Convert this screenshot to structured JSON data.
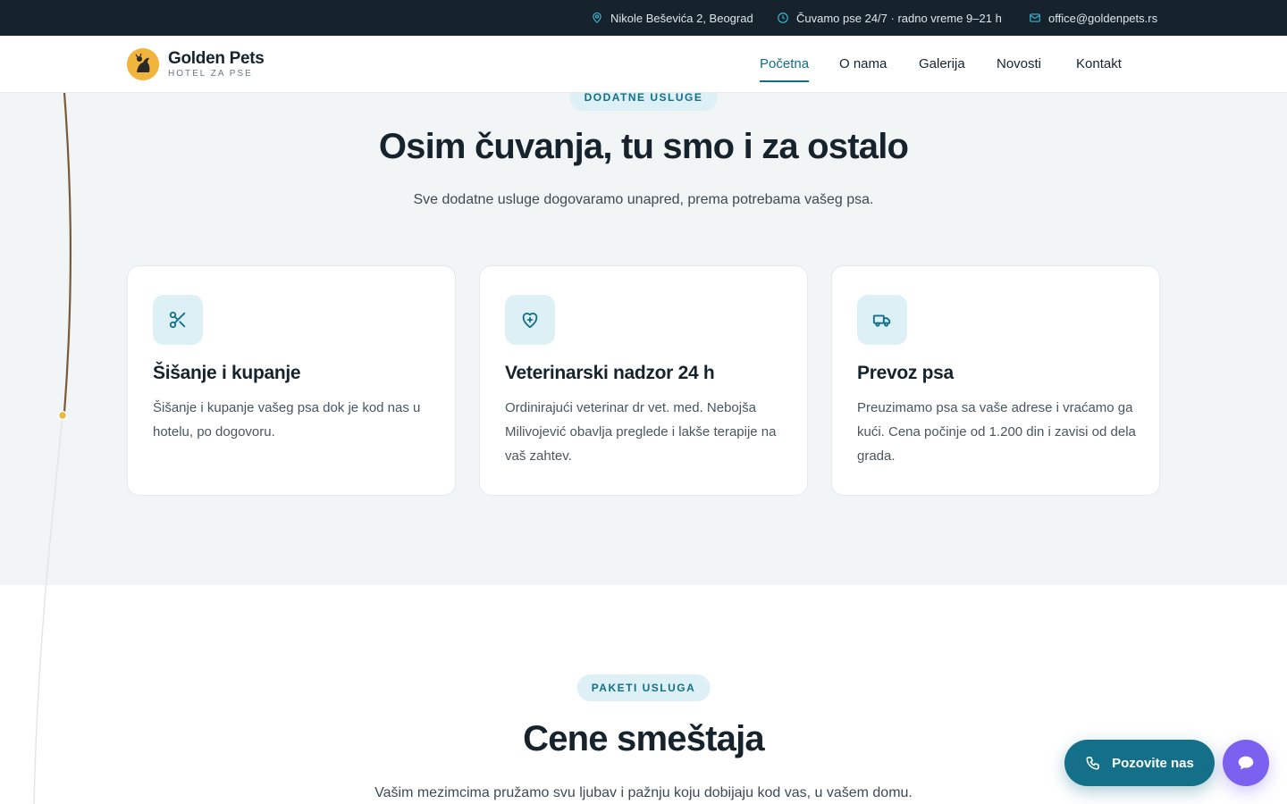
{
  "topbar": {
    "address": "Nikole Beševića 2, Beograd",
    "hours": "Čuvamo pse 24/7 · radno vreme 9–21 h",
    "email": "office@goldenpets.rs"
  },
  "brand": {
    "name": "Golden Pets",
    "tagline": "HOTEL ZA PSE"
  },
  "nav": {
    "items": [
      {
        "label": "Početna",
        "active": true
      },
      {
        "label": "O nama"
      },
      {
        "label": "Galerija"
      },
      {
        "label": "Novosti"
      },
      {
        "label": "Kontakt"
      }
    ]
  },
  "services": {
    "eyebrow": "DODATNE USLUGE",
    "title": "Osim čuvanja, tu smo i za ostalo",
    "lead": "Sve dodatne usluge dogovaramo unapred, prema potrebama vašeg psa.",
    "cards": [
      {
        "icon": "scissors-icon",
        "title": "Šišanje i kupanje",
        "desc": "Šišanje i kupanje vašeg psa dok je kod nas u hotelu, po dogovoru."
      },
      {
        "icon": "shield-plus-icon",
        "title": "Veterinarski nadzor 24 h",
        "desc": "Ordinirajući veterinar dr vet. med. Nebojša Milivojević obavlja preglede i lakše terapije na vaš zahtev."
      },
      {
        "icon": "truck-icon",
        "title": "Prevoz psa",
        "desc": "Preuzimamo psa sa vaše adrese i vraćamo ga kući. Cena počinje od 1.200 din i zavisi od dela grada."
      }
    ]
  },
  "pricing": {
    "eyebrow": "PAKETI USLUGA",
    "title": "Cene smeštaja",
    "lead": "Vašim mezimcima pružamo svu ljubav i pažnju koju dobijaju kod vas, u vašem domu."
  },
  "floating": {
    "call_label": "Pozovite nas"
  },
  "colors": {
    "topbar_bg": "#16232c",
    "accent": "#137088",
    "chat": "#7b61f0",
    "logo": "#f1b53b"
  }
}
